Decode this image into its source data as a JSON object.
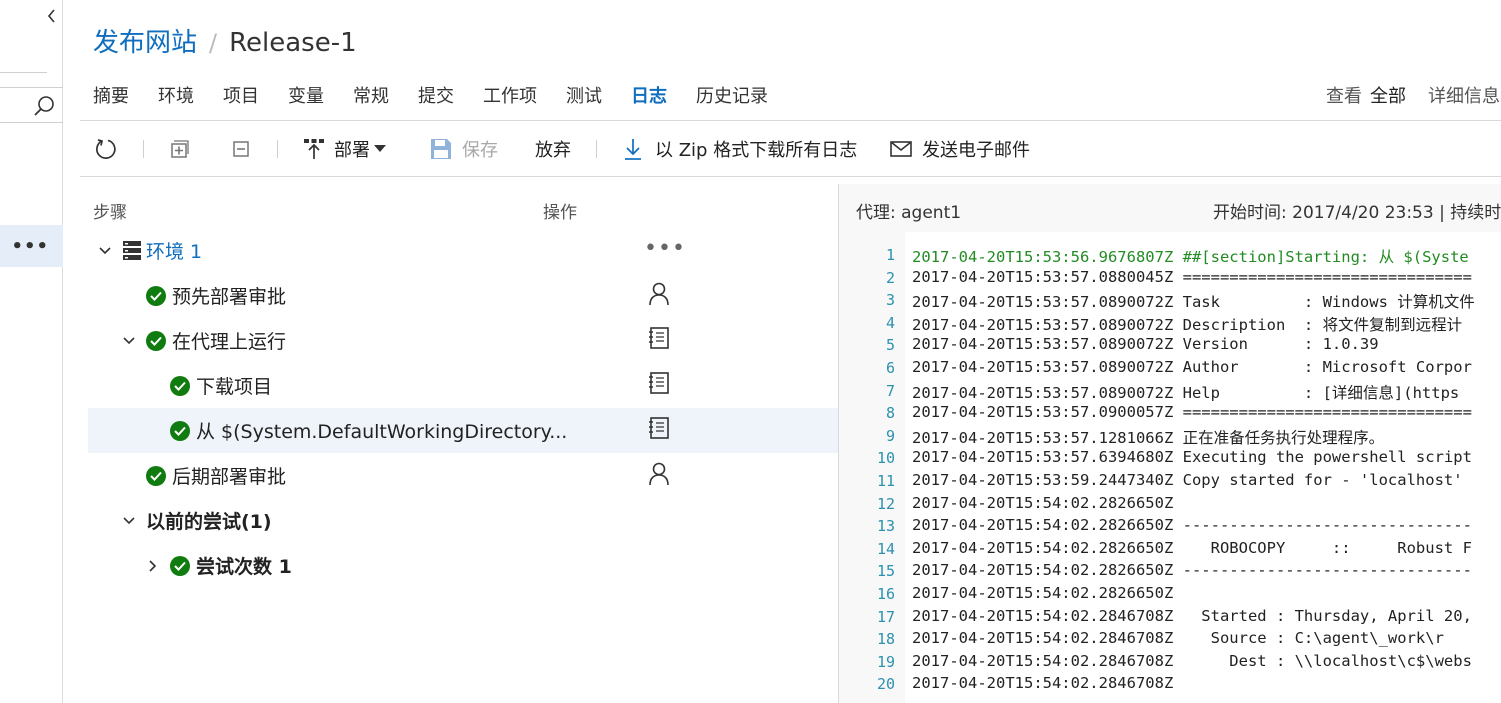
{
  "breadcrumb": {
    "root": "发布网站",
    "separator": "/",
    "current": "Release-1"
  },
  "tabs": [
    "摘要",
    "环境",
    "项目",
    "变量",
    "常规",
    "提交",
    "工作项",
    "测试",
    "日志",
    "历史记录"
  ],
  "view": {
    "label": "查看",
    "value": "全部",
    "details": "详细信息"
  },
  "toolbar": {
    "deploy": "部署",
    "save": "保存",
    "discard": "放弃",
    "download": "以 Zip 格式下载所有日志",
    "email": "发送电子邮件"
  },
  "tree": {
    "col_steps": "步骤",
    "col_actions": "操作",
    "env_name": "环境 1",
    "pre_approval": "预先部署审批",
    "run_on_agent": "在代理上运行",
    "download_artifacts": "下载项目",
    "copy_task": "从 $(System.DefaultWorkingDirectory...",
    "post_approval": "后期部署审批",
    "previous_attempts": "以前的尝试(1)",
    "attempt_1": "尝试次数 1"
  },
  "rail": {
    "more": "•••"
  },
  "op_more": "•••",
  "log": {
    "agent": "代理: agent1",
    "start": "开始时间: 2017/4/20 23:53 | 持续时",
    "lines": [
      {
        "n": "1",
        "text": "2017-04-20T15:53:56.9676807Z ##[section]Starting: 从 $(Syste"
      },
      {
        "n": "2",
        "text": "2017-04-20T15:53:57.0880045Z ==============================="
      },
      {
        "n": "3",
        "text": "2017-04-20T15:53:57.0890072Z Task         : Windows 计算机文件"
      },
      {
        "n": "4",
        "text": "2017-04-20T15:53:57.0890072Z Description  : 将文件复制到远程计"
      },
      {
        "n": "5",
        "text": "2017-04-20T15:53:57.0890072Z Version      : 1.0.39"
      },
      {
        "n": "6",
        "text": "2017-04-20T15:53:57.0890072Z Author       : Microsoft Corpor"
      },
      {
        "n": "7",
        "text": "2017-04-20T15:53:57.0890072Z Help         : [详细信息](https"
      },
      {
        "n": "8",
        "text": "2017-04-20T15:53:57.0900057Z ==============================="
      },
      {
        "n": "9",
        "text": "2017-04-20T15:53:57.1281066Z 正在准备任务执行处理程序。"
      },
      {
        "n": "10",
        "text": "2017-04-20T15:53:57.6394680Z Executing the powershell script"
      },
      {
        "n": "11",
        "text": "2017-04-20T15:53:59.2447340Z Copy started for - 'localhost'"
      },
      {
        "n": "12",
        "text": "2017-04-20T15:54:02.2826650Z"
      },
      {
        "n": "13",
        "text": "2017-04-20T15:54:02.2826650Z -------------------------------"
      },
      {
        "n": "14",
        "text": "2017-04-20T15:54:02.2826650Z    ROBOCOPY     ::     Robust F"
      },
      {
        "n": "15",
        "text": "2017-04-20T15:54:02.2826650Z -------------------------------"
      },
      {
        "n": "16",
        "text": "2017-04-20T15:54:02.2826650Z"
      },
      {
        "n": "17",
        "text": "2017-04-20T15:54:02.2846708Z   Started : Thursday, April 20,"
      },
      {
        "n": "18",
        "text": "2017-04-20T15:54:02.2846708Z    Source : C:\\agent\\_work\\r"
      },
      {
        "n": "19",
        "text": "2017-04-20T15:54:02.2846708Z      Dest : \\\\localhost\\c$\\webs"
      },
      {
        "n": "20",
        "text": "2017-04-20T15:54:02.2846708Z"
      }
    ]
  },
  "colors": {
    "accent": "#106ebe",
    "success": "#107c10",
    "log_green": "#228b22",
    "line_number": "#2b91af"
  }
}
